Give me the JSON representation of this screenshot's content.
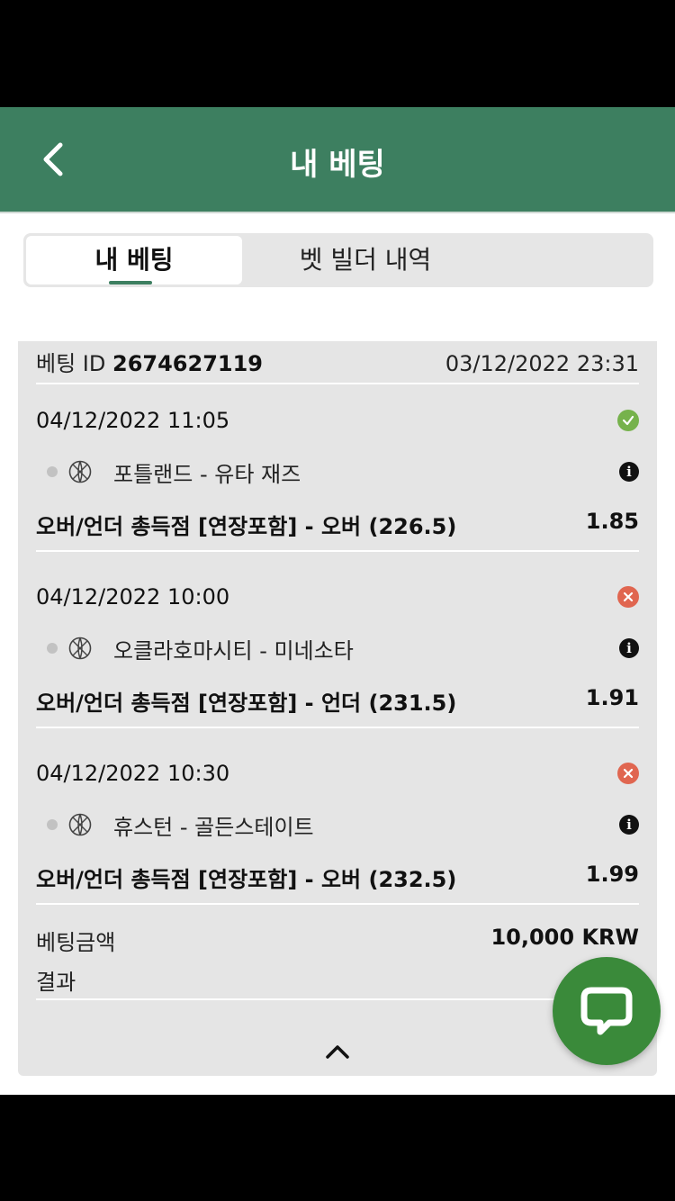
{
  "header": {
    "title": "내 베팅"
  },
  "tabs": [
    {
      "label": "내 베팅",
      "active": true
    },
    {
      "label": "벳 빌더 내역",
      "active": false
    }
  ],
  "bet": {
    "id_label": "베팅 ID",
    "id": "2674627119",
    "placed_at": "03/12/2022 23:31",
    "selections": [
      {
        "time": "04/12/2022 11:05",
        "status": "won",
        "status_icon": "check-icon",
        "teams": "포틀랜드 - 유타 재즈",
        "market": "오버/언더 총득점 [연장포함] - 오버 (226.5)",
        "odds": "1.85"
      },
      {
        "time": "04/12/2022 10:00",
        "status": "lost",
        "status_icon": "x-icon",
        "teams": "오클라호마시티 - 미네소타",
        "market": "오버/언더 총득점 [연장포함] - 언더 (231.5)",
        "odds": "1.91"
      },
      {
        "time": "04/12/2022 10:30",
        "status": "lost",
        "status_icon": "x-icon",
        "teams": "휴스턴 - 골든스테이트",
        "market": "오버/언더 총득점 [연장포함] - 오버 (232.5)",
        "odds": "1.99"
      }
    ],
    "stake_label": "베팅금액",
    "stake": "10,000 KRW",
    "result_label": "결과"
  },
  "colors": {
    "brand": "#3d7f60",
    "win": "#76b24c",
    "lose": "#e06650",
    "fab": "#3a8a3a"
  }
}
